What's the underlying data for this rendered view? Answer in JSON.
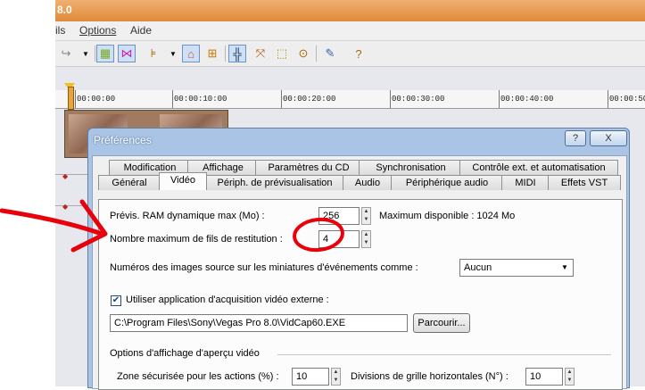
{
  "app": {
    "title": "8.0",
    "menu": [
      "ils",
      "Options",
      "Aide"
    ]
  },
  "timeline": {
    "ticks": [
      "00:00:00",
      "00:00:10:00",
      "00:00:20:00",
      "00:00:30:00",
      "00:00:40:00",
      "00:00:50:"
    ]
  },
  "dialog": {
    "title": "Préférences",
    "help_button": "?",
    "close_button": "X",
    "tabs_row1": [
      "Modification",
      "Affichage",
      "Paramètres du CD",
      "Synchronisation",
      "Contrôle ext. et automatisation"
    ],
    "tabs_row2": [
      "Général",
      "Vidéo",
      "Périph. de prévisualisation",
      "Audio",
      "Périphérique audio",
      "MIDI",
      "Effets VST"
    ],
    "active_tab": "Vidéo",
    "ram_label": "Prévis. RAM dynamique max (Mo) :",
    "ram_value": "256",
    "ram_available": "Maximum disponible : 1024 Mo",
    "threads_label": "Nombre maximum de fils de restitution :",
    "threads_value": "4",
    "source_numbers_label": "Numéros des images source sur les miniatures d'événements comme :",
    "source_numbers_value": "Aucun",
    "capture_checkbox_label": "Utiliser application d'acquisition vidéo externe :",
    "capture_checked": true,
    "capture_path": "C:\\Program Files\\Sony\\Vegas Pro 8.0\\VidCap60.EXE",
    "browse_button": "Parcourir...",
    "preview_group_label": "Options d'affichage d'aperçu vidéo",
    "safe_zone_label": "Zone sécurisée pour les actions (%) :",
    "safe_zone_value": "10",
    "grid_label": "Divisions de grille horizontales (N°) :",
    "grid_value": "10"
  },
  "colors": {
    "annotation": "#e8000b",
    "dialog_frame": "#a9c4e4",
    "title_bar": "#e08a3c"
  }
}
